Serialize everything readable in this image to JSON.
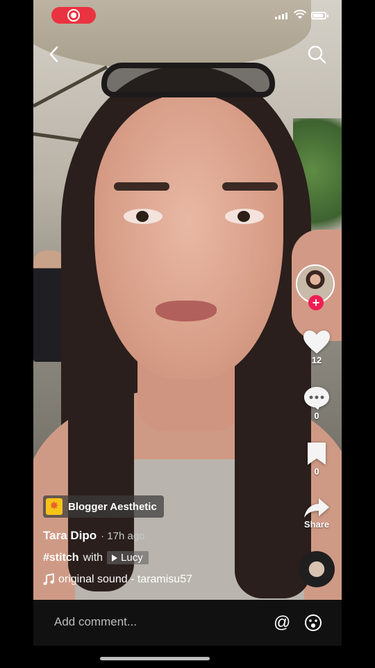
{
  "status_bar": {
    "recording": true
  },
  "nav": {
    "back_icon": "chevron-left-icon",
    "search_icon": "search-icon"
  },
  "actions": {
    "follow_symbol": "+",
    "likes": "12",
    "comments": "0",
    "saves": "0",
    "share_label": "Share"
  },
  "video": {
    "effect_label": "Blogger Aesthetic",
    "author": "Tara Dipo",
    "time_ago": "· 17h ago",
    "hashtag": "#stitch",
    "with_text": "with",
    "stitch_user": "Lucy",
    "sound": "original sound - taramisu57"
  },
  "comment_bar": {
    "placeholder": "Add comment...",
    "mention_symbol": "@"
  },
  "colors": {
    "accent": "#ee1d52",
    "rec": "#ea3340",
    "bar_bg": "#111111"
  }
}
